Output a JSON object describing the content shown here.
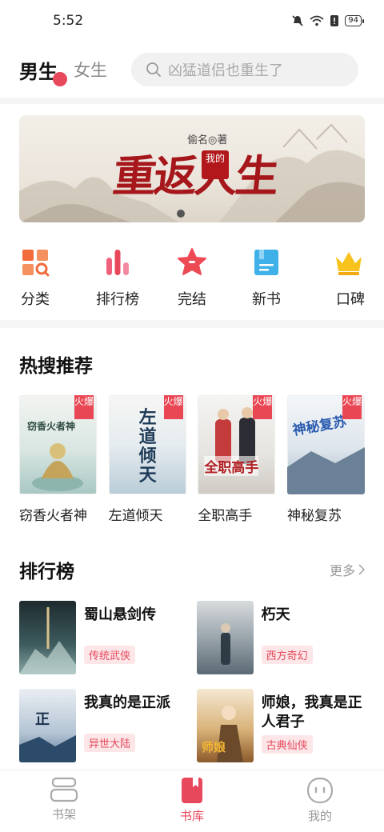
{
  "status": {
    "time": "5:52",
    "battery": "94"
  },
  "header": {
    "tab_male": "男生",
    "tab_female": "女生",
    "search_placeholder": "凶猛道侣也重生了"
  },
  "banner": {
    "author": "偷名◎著",
    "title": "重返人生",
    "seal": "我的"
  },
  "quick_nav": [
    {
      "label": "分类",
      "icon": "category-icon"
    },
    {
      "label": "排行榜",
      "icon": "ranking-icon"
    },
    {
      "label": "完结",
      "icon": "star-icon"
    },
    {
      "label": "新书",
      "icon": "new-book-icon"
    },
    {
      "label": "口碑",
      "icon": "crown-icon"
    }
  ],
  "hot_search": {
    "title": "热搜推荐",
    "badge": "火爆",
    "books": [
      {
        "name": "窃香火者神",
        "cover_text": "窃香火者神"
      },
      {
        "name": "左道倾天",
        "cover_text": "左道倾天"
      },
      {
        "name": "全职高手",
        "cover_text": "全职高手"
      },
      {
        "name": "神秘复苏",
        "cover_text": "神秘复苏"
      }
    ]
  },
  "ranking": {
    "title": "排行榜",
    "more": "更多",
    "books": [
      {
        "name": "蜀山悬剑传",
        "tag": "传统武侠"
      },
      {
        "name": "朽天",
        "tag": "西方奇幻"
      },
      {
        "name": "我真的是正派",
        "tag": "异世大陆"
      },
      {
        "name": "师娘，我真是正人君子",
        "tag": "古典仙侠"
      }
    ]
  },
  "bottom_nav": [
    {
      "label": "书架"
    },
    {
      "label": "书库"
    },
    {
      "label": "我的"
    }
  ],
  "colors": {
    "accent": "#e8485c",
    "tag_bg": "#fde6e8"
  }
}
